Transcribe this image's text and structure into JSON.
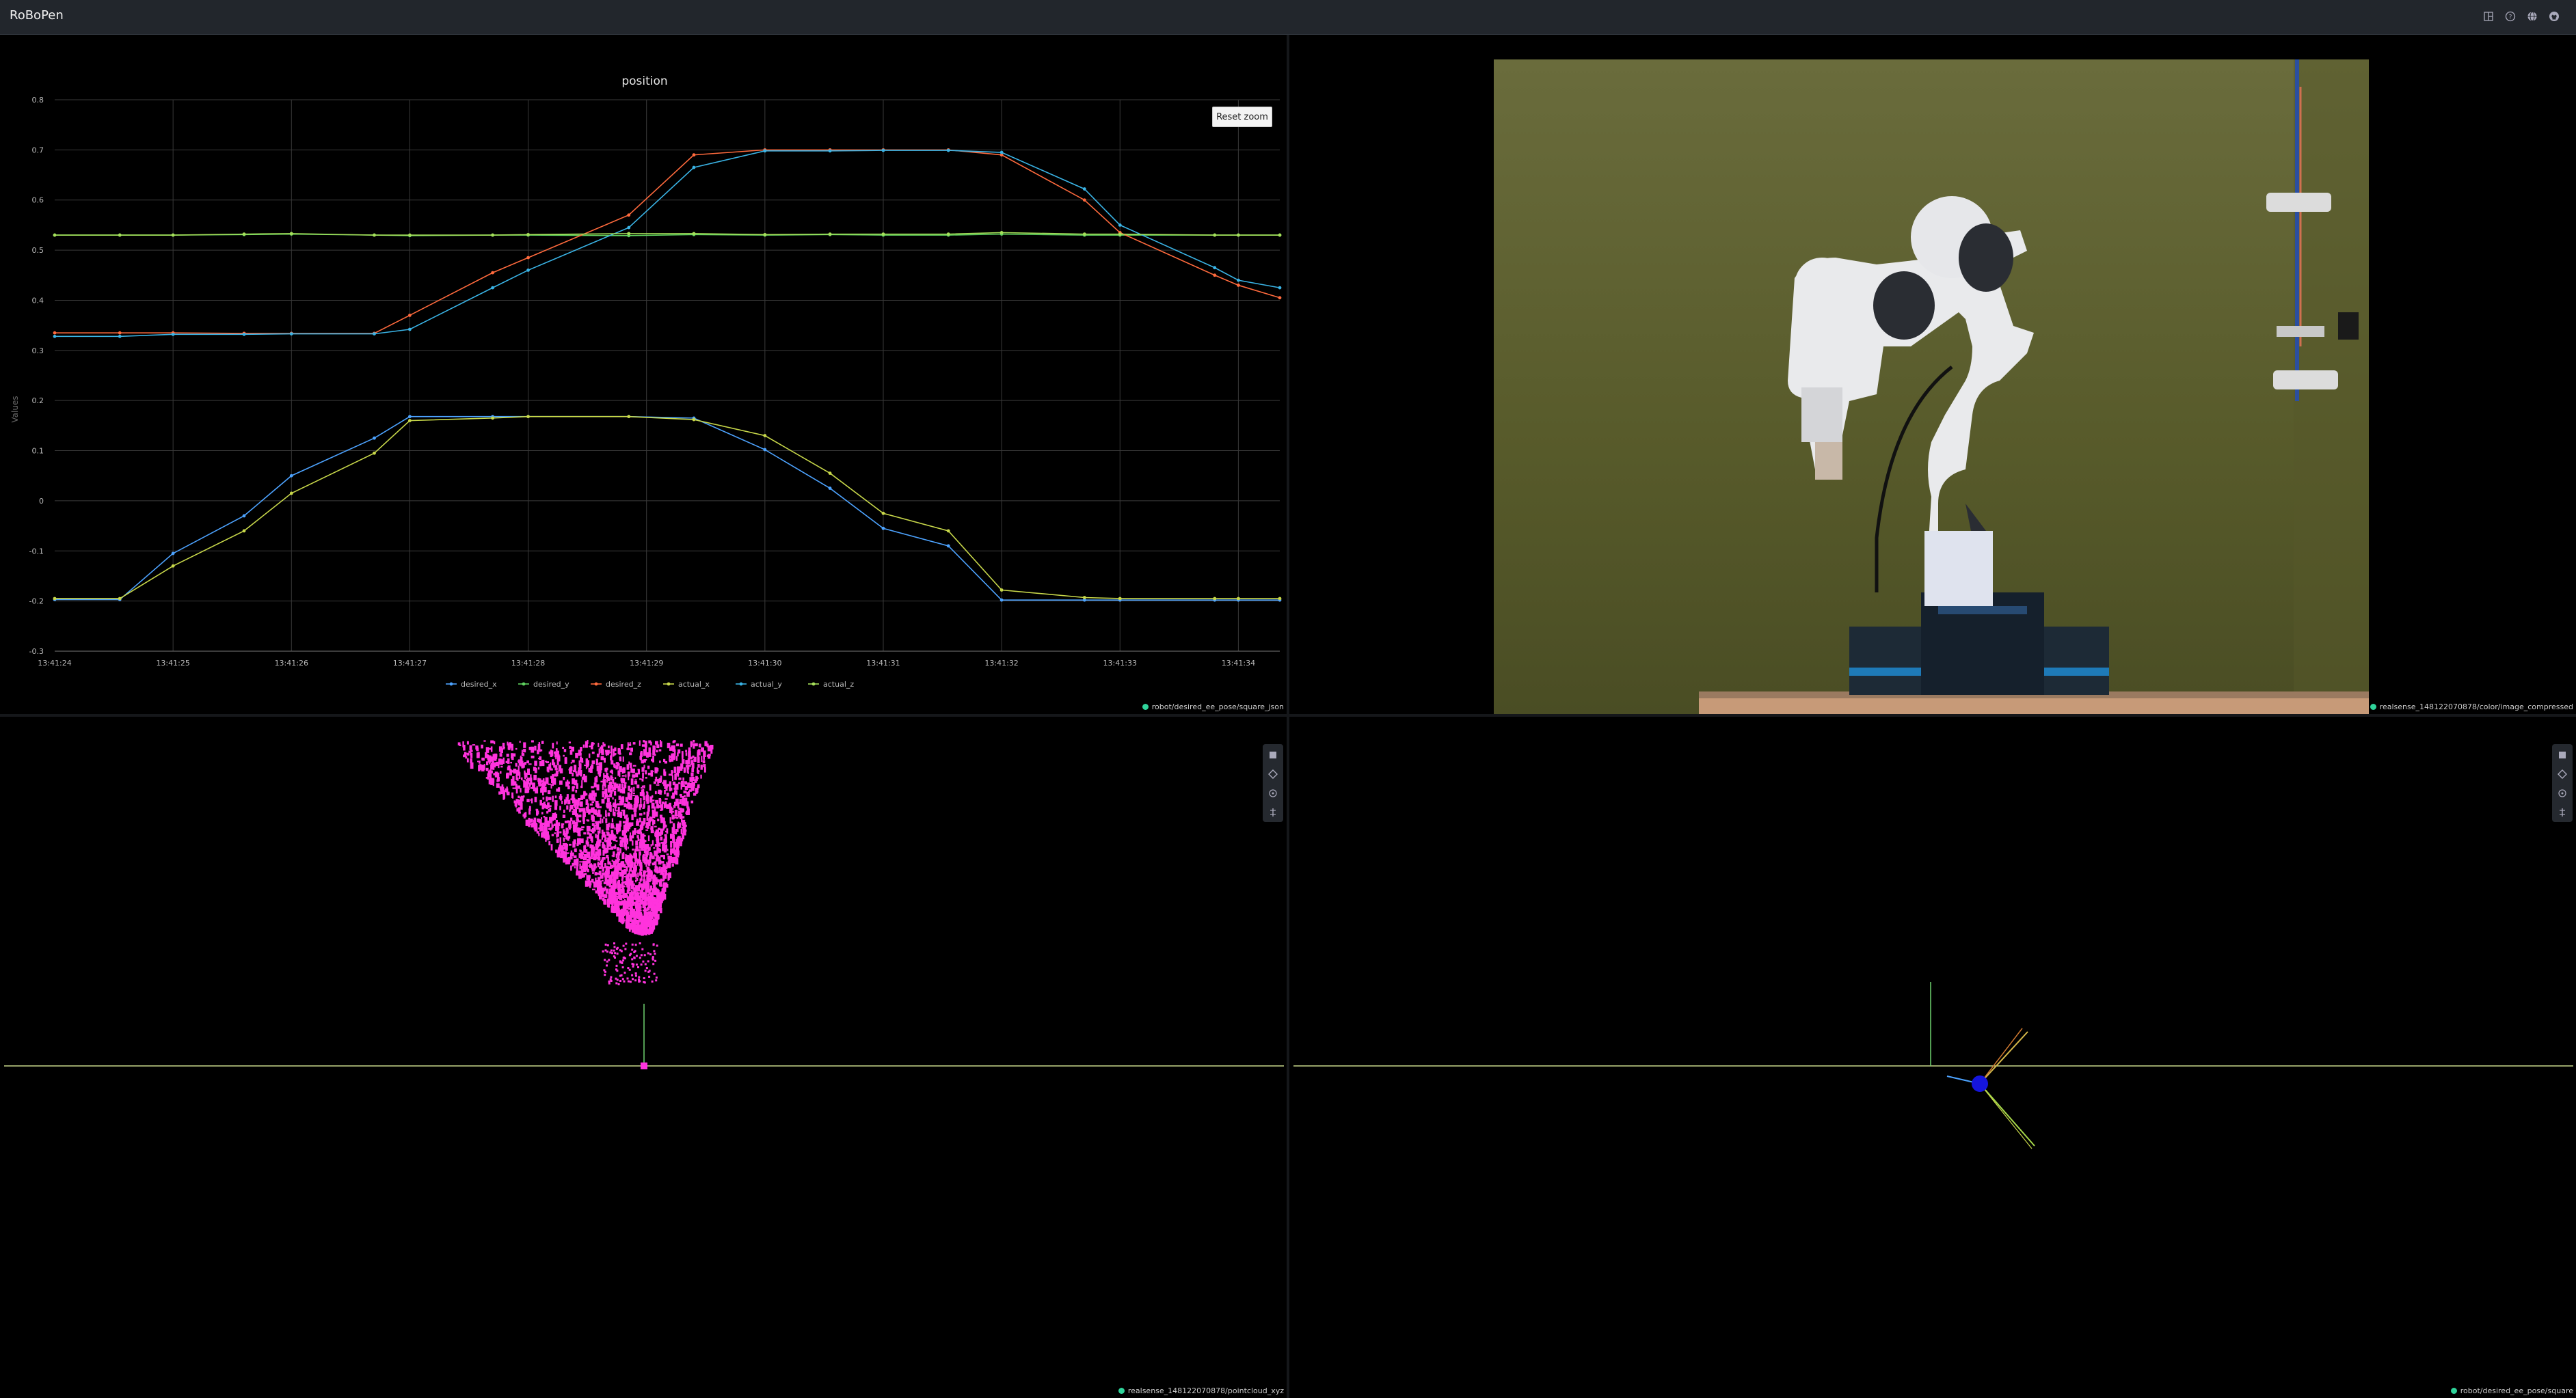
{
  "app": {
    "title": "RoBoPen",
    "header_icons": [
      "layout-icon",
      "help-icon",
      "globe-icon",
      "github-icon"
    ]
  },
  "chart_panel": {
    "reset_zoom_label": "Reset zoom",
    "topic": "robot/desired_ee_pose/square_json"
  },
  "image_panel": {
    "topic": "realsense_148122070878/color/image_compressed"
  },
  "cloud_panel": {
    "topic": "realsense_148122070878/pointcloud_xyz",
    "point_color": "#ff33dd"
  },
  "pose_panel": {
    "topic": "robot/desired_ee_pose/square"
  },
  "colors": {
    "desired_x": "#4da3ff",
    "desired_y": "#5fd35f",
    "desired_z": "#ff6a3d",
    "actual_x": "#c8d84a",
    "actual_y": "#3ab4e6",
    "actual_z": "#a6e05a",
    "accent": "#2fd39a"
  },
  "chart_data": {
    "type": "line",
    "title": "position",
    "xlabel": "",
    "ylabel": "Values",
    "x": [
      "13:41:24",
      "13:41:24.55",
      "13:41:25",
      "13:41:25.6",
      "13:41:26",
      "13:41:26.7",
      "13:41:27",
      "13:41:27.7",
      "13:41:28",
      "13:41:28.85",
      "13:41:29.4",
      "13:41:30",
      "13:41:30.55",
      "13:41:31",
      "13:41:31.55",
      "13:41:32",
      "13:41:32.7",
      "13:41:33",
      "13:41:33.8",
      "13:41:34",
      "13:41:34.35"
    ],
    "x_ticks": [
      "13:41:24",
      "13:41:25",
      "13:41:26",
      "13:41:27",
      "13:41:28",
      "13:41:29",
      "13:41:30",
      "13:41:31",
      "13:41:32",
      "13:41:33",
      "13:41:34"
    ],
    "y_ticks": [
      "-0.3",
      "-0.2",
      "-0.1",
      "0",
      "0.1",
      "0.2",
      "0.3",
      "0.4",
      "0.5",
      "0.6",
      "0.7",
      "0.8"
    ],
    "ylim": [
      -0.3,
      0.8
    ],
    "grid": true,
    "legend_position": "bottom",
    "series": [
      {
        "name": "desired_x",
        "values": [
          -0.197,
          -0.197,
          -0.105,
          -0.03,
          0.05,
          0.125,
          0.168,
          0.168,
          0.168,
          0.168,
          0.165,
          0.102,
          0.025,
          -0.055,
          -0.09,
          -0.198,
          -0.198,
          -0.198,
          -0.198,
          -0.198,
          -0.198
        ]
      },
      {
        "name": "desired_y",
        "values": [
          0.53,
          0.53,
          0.53,
          0.531,
          0.532,
          0.53,
          0.529,
          0.53,
          0.53,
          0.529,
          0.531,
          0.53,
          0.531,
          0.53,
          0.53,
          0.532,
          0.53,
          0.53,
          0.53,
          0.53,
          0.53
        ]
      },
      {
        "name": "desired_z",
        "values": [
          0.335,
          0.335,
          0.335,
          0.334,
          0.334,
          0.334,
          0.37,
          0.455,
          0.485,
          0.57,
          0.69,
          0.7,
          0.7,
          0.7,
          0.7,
          0.69,
          0.6,
          0.535,
          0.45,
          0.43,
          0.405
        ]
      },
      {
        "name": "actual_x",
        "values": [
          -0.195,
          -0.195,
          -0.13,
          -0.06,
          0.015,
          0.095,
          0.16,
          0.165,
          0.168,
          0.168,
          0.162,
          0.13,
          0.055,
          -0.025,
          -0.06,
          -0.178,
          -0.193,
          -0.195,
          -0.195,
          -0.195,
          -0.195
        ]
      },
      {
        "name": "actual_y",
        "values": [
          0.328,
          0.328,
          0.332,
          0.332,
          0.333,
          0.333,
          0.342,
          0.425,
          0.46,
          0.545,
          0.665,
          0.698,
          0.698,
          0.699,
          0.699,
          0.695,
          0.622,
          0.55,
          0.465,
          0.44,
          0.425
        ]
      },
      {
        "name": "actual_z",
        "values": [
          0.53,
          0.53,
          0.53,
          0.532,
          0.533,
          0.53,
          0.53,
          0.53,
          0.531,
          0.533,
          0.533,
          0.531,
          0.532,
          0.532,
          0.532,
          0.535,
          0.532,
          0.532,
          0.53,
          0.53,
          0.53
        ]
      }
    ]
  }
}
